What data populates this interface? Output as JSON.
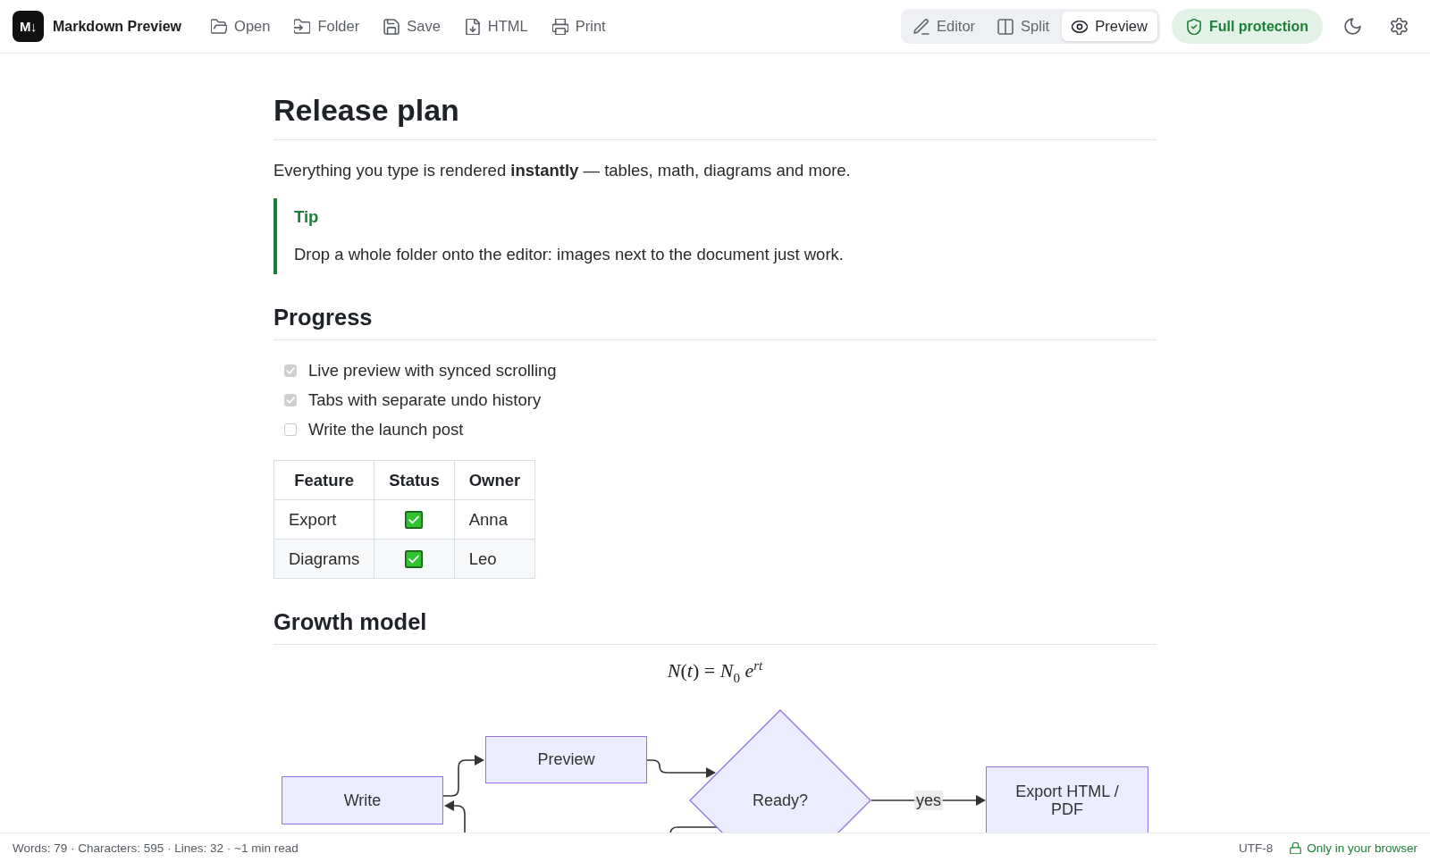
{
  "toolbar": {
    "logo_text": "M↓",
    "app_name": "Markdown Preview",
    "actions": [
      "Open",
      "Folder",
      "Save",
      "HTML",
      "Print"
    ],
    "view_modes": [
      {
        "label": "Editor",
        "selected": false
      },
      {
        "label": "Split",
        "selected": false
      },
      {
        "label": "Preview",
        "selected": true
      }
    ],
    "protection": "Full protection"
  },
  "document": {
    "blocks": [
      {
        "kind": "title",
        "text": "Release plan"
      },
      {
        "kind": "paragraph",
        "text": "Everything you type is rendered **instantly** — tables, math, diagrams and more."
      },
      {
        "kind": "callout",
        "title": "Tip",
        "text": "Drop a whole folder onto the editor: images next to the document just work."
      },
      {
        "kind": "heading",
        "text": "Progress"
      },
      {
        "kind": "tasklist",
        "items": [
          {
            "text": "Live preview with synced scrolling",
            "checked": true,
            "disabled": true
          },
          {
            "text": "Tabs with separate undo history",
            "checked": true,
            "disabled": true
          },
          {
            "text": "Write the launch post",
            "checked": false,
            "disabled": true
          }
        ]
      },
      {
        "kind": "table",
        "columns": [
          "Feature",
          "Status",
          "Owner"
        ],
        "rows": [
          {
            "cells": [
              {
                "kind": "text",
                "text": "Export"
              },
              {
                "kind": "check",
                "checked": true
              },
              {
                "kind": "text",
                "text": "Anna"
              }
            ]
          },
          {
            "cells": [
              {
                "kind": "text",
                "text": "Diagrams"
              },
              {
                "kind": "check",
                "checked": true
              },
              {
                "kind": "text",
                "text": "Leo"
              }
            ]
          }
        ]
      },
      {
        "kind": "heading",
        "text": "Growth model"
      },
      {
        "kind": "math",
        "text": "*N*(*t*) = *N*$_{0}$ *e*$^{rt}$"
      },
      {
        "kind": "flowchart",
        "nodes": [
          {
            "kind": "process",
            "label": "Write"
          },
          {
            "kind": "process",
            "label": "Preview"
          },
          {
            "kind": "decision",
            "label": "Ready?"
          },
          {
            "kind": "process",
            "label": "Export HTML / PDF"
          }
        ],
        "edge_labels": [
          "yes"
        ]
      }
    ]
  },
  "status_bar": {
    "stats": "Words: 79 · Characters: 595 · Lines: 32 · ~1 min read",
    "encoding": "UTF-8",
    "privacy": "Only in your browser"
  }
}
